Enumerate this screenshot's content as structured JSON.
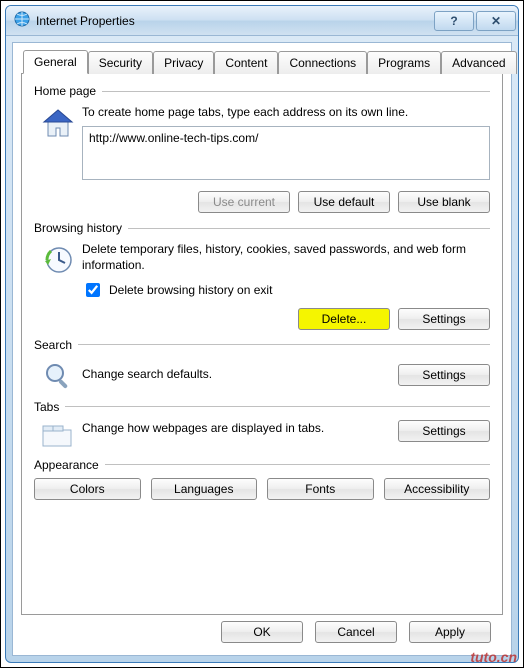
{
  "window": {
    "title": "Internet Properties",
    "help_btn": "?",
    "close_btn": "✕"
  },
  "tabs": [
    "General",
    "Security",
    "Privacy",
    "Content",
    "Connections",
    "Programs",
    "Advanced"
  ],
  "active_tab": 0,
  "homepage": {
    "heading": "Home page",
    "desc": "To create home page tabs, type each address on its own line.",
    "value": "http://www.online-tech-tips.com/",
    "use_current": "Use current",
    "use_default": "Use default",
    "use_blank": "Use blank"
  },
  "history": {
    "heading": "Browsing history",
    "desc": "Delete temporary files, history, cookies, saved passwords, and web form information.",
    "checkbox_label": "Delete browsing history on exit",
    "checkbox_checked": true,
    "delete_btn": "Delete...",
    "settings_btn": "Settings"
  },
  "search": {
    "heading": "Search",
    "desc": "Change search defaults.",
    "settings_btn": "Settings"
  },
  "tabs_section": {
    "heading": "Tabs",
    "desc": "Change how webpages are displayed in tabs.",
    "settings_btn": "Settings"
  },
  "appearance": {
    "heading": "Appearance",
    "colors": "Colors",
    "languages": "Languages",
    "fonts": "Fonts",
    "accessibility": "Accessibility"
  },
  "footer": {
    "ok": "OK",
    "cancel": "Cancel",
    "apply": "Apply"
  },
  "watermark": "tuto.cn"
}
